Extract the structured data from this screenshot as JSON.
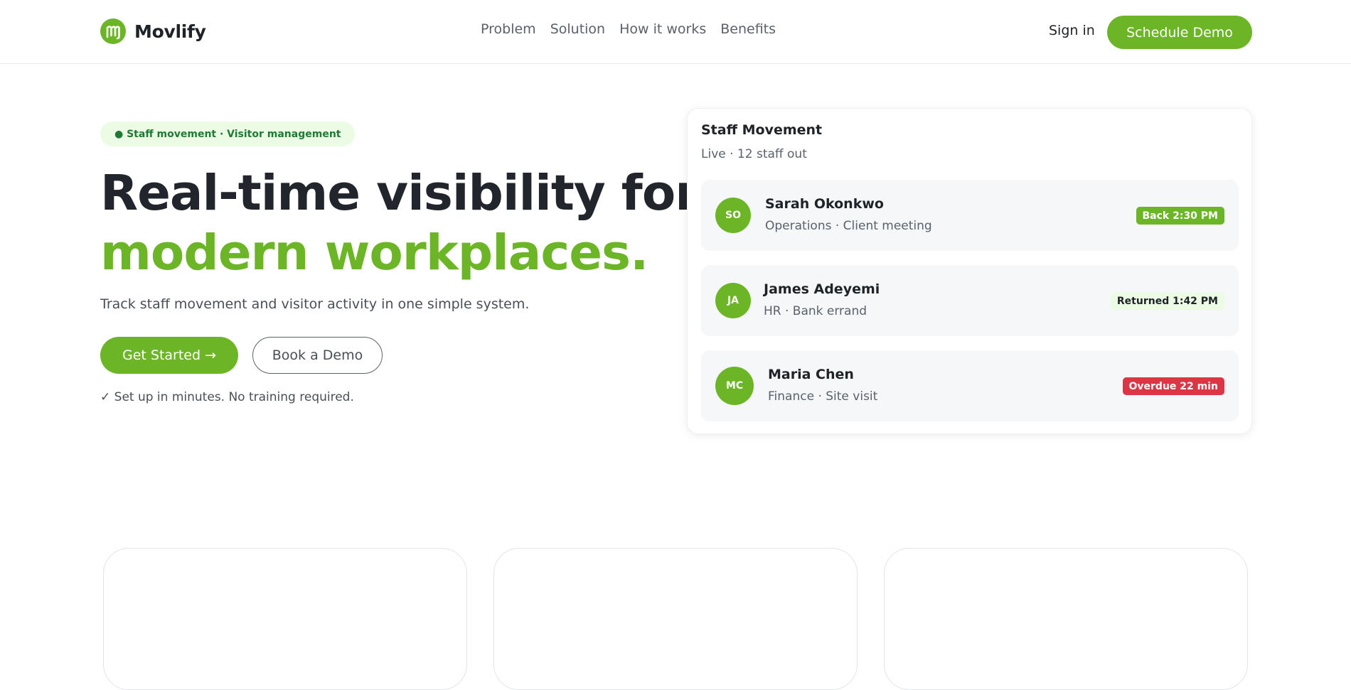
{
  "header": {
    "brand": "Movlify",
    "nav": [
      "Problem",
      "Solution",
      "How it works",
      "Benefits"
    ],
    "signin": "Sign in",
    "cta": "Schedule Demo"
  },
  "hero": {
    "pill": "● Staff movement · Visitor management",
    "title_line1": "Real-time visibility for",
    "title_line2": "modern workplaces.",
    "subtitle": "Track staff movement and visitor activity in one simple system.",
    "primary_button": "Get Started →",
    "secondary_button": "Book a Demo",
    "note": "✓ Set up in minutes. No training required."
  },
  "staff_card": {
    "title": "Staff Movement",
    "subtitle": "Live · 12 staff out",
    "rows": [
      {
        "initials": "SO",
        "name": "Sarah Okonkwo",
        "meta": "Operations · Client meeting",
        "status": "Back 2:30 PM",
        "status_color": "#6bb526"
      },
      {
        "initials": "JA",
        "name": "James Adeyemi",
        "meta": "HR · Bank errand",
        "status": "Returned 1:42 PM",
        "status_color": "#ecfbe4"
      },
      {
        "initials": "MC",
        "name": "Maria Chen",
        "meta": "Finance · Site visit",
        "status": "Overdue 22 min",
        "status_color": "#dc3545"
      }
    ]
  },
  "colors": {
    "brand": "#6bb526",
    "pill_bg": "#ecfbe4",
    "danger": "#dc3545"
  }
}
